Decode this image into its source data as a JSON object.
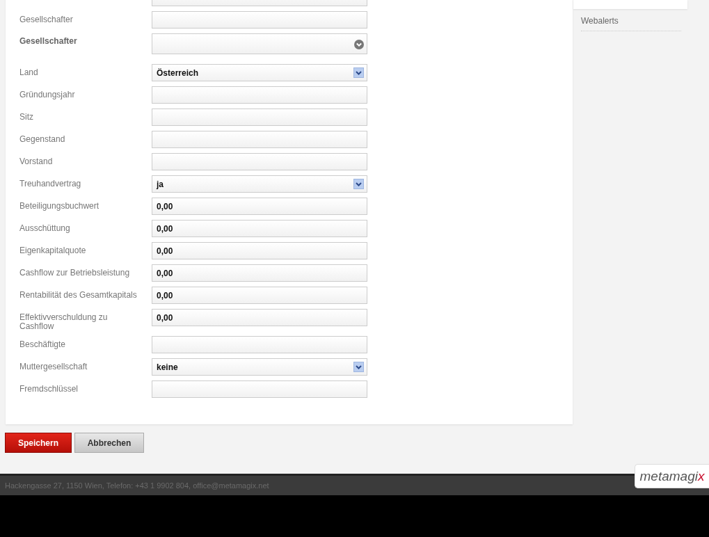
{
  "form": {
    "fields": [
      {
        "kind": "text"
      },
      {
        "kind": "text",
        "label": "Gesellschafter"
      },
      {
        "kind": "combo",
        "label": "Gesellschafter",
        "emphasized": true
      },
      {
        "kind": "select",
        "label": "Land",
        "value": "Österreich"
      },
      {
        "kind": "text",
        "label": "Gründungsjahr"
      },
      {
        "kind": "text",
        "label": "Sitz"
      },
      {
        "kind": "text",
        "label": "Gegenstand"
      },
      {
        "kind": "text",
        "label": "Vorstand"
      },
      {
        "kind": "select",
        "label": "Treuhandvertrag",
        "value": "ja"
      },
      {
        "kind": "text",
        "label": "Beteiligungsbuchwert",
        "value": "0,00"
      },
      {
        "kind": "text",
        "label": "Ausschüttung",
        "value": "0,00"
      },
      {
        "kind": "text",
        "label": "Eigenkapitalquote",
        "value": "0,00"
      },
      {
        "kind": "text",
        "label": "Cashflow zur Betriebsleistung",
        "value": "0,00"
      },
      {
        "kind": "text",
        "label": "Rentabilität des Gesamtkapitals",
        "value": "0,00"
      },
      {
        "kind": "text",
        "label": "Effektivverschuldung zu Cashflow",
        "value": "0,00"
      },
      {
        "kind": "text",
        "label": "Beschäftigte"
      },
      {
        "kind": "select",
        "label": "Muttergesellschaft",
        "value": "keine"
      },
      {
        "kind": "text",
        "label": "Fremdschlüssel"
      }
    ]
  },
  "sidebar": {
    "items": [
      {
        "label": "Webalerts"
      }
    ]
  },
  "buttons": [
    {
      "label": "Speichern",
      "kind": "primary"
    },
    {
      "label": "Abbrechen",
      "kind": "secondary"
    }
  ],
  "footer": {
    "address": "Hackengasse 27, 1150 Wien, Telefon: +43 1 9902 804, office@metamagix.net",
    "logo": "metamagix"
  }
}
